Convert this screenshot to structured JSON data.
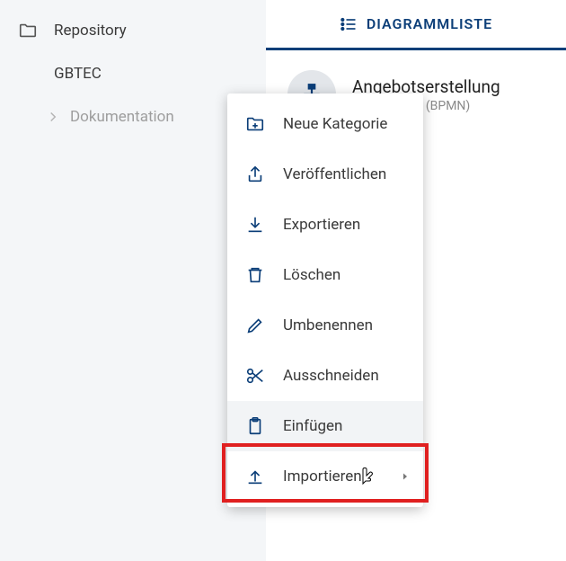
{
  "sidebar": {
    "repository_label": "Repository",
    "items": [
      {
        "label": "GBTEC"
      },
      {
        "label": "Dokumentation"
      }
    ]
  },
  "main": {
    "tab_label": "DIAGRAMMLISTE",
    "list": [
      {
        "title": "Angebotserstellung",
        "subtitle": "nsdiagramm (BPMN)"
      }
    ]
  },
  "context_menu": {
    "items": [
      {
        "key": "new-category",
        "label": "Neue Kategorie"
      },
      {
        "key": "publish",
        "label": "Veröffentlichen"
      },
      {
        "key": "export",
        "label": "Exportieren"
      },
      {
        "key": "delete",
        "label": "Löschen"
      },
      {
        "key": "rename",
        "label": "Umbenennen"
      },
      {
        "key": "cut",
        "label": "Ausschneiden"
      },
      {
        "key": "paste",
        "label": "Einfügen"
      },
      {
        "key": "import",
        "label": "Importieren",
        "has_submenu": true
      }
    ],
    "highlighted_key": "paste"
  },
  "colors": {
    "accent": "#0b3e78",
    "highlight": "#e02020"
  }
}
